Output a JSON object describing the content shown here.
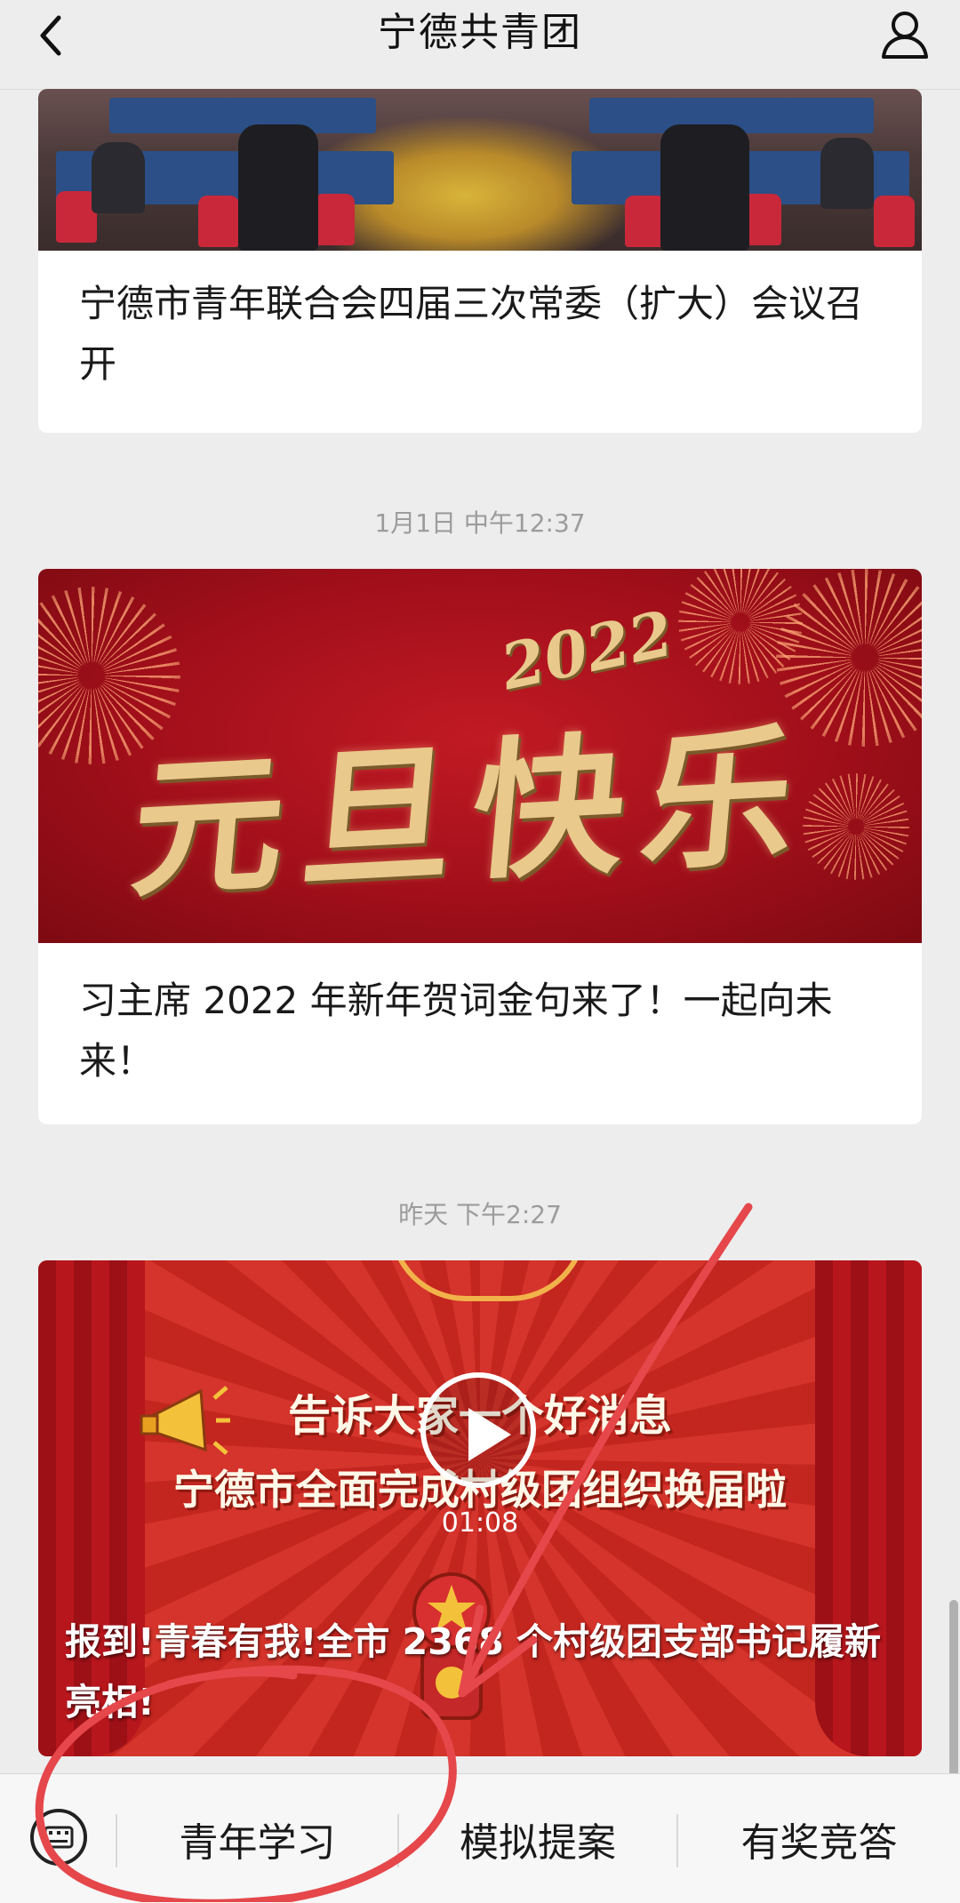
{
  "header": {
    "title": "宁德共青团"
  },
  "feed": {
    "articles": [
      {
        "title": "宁德市青年联合会四届三次常委（扩大）会议召开"
      },
      {
        "timestamp": "1月1日 中午12:37",
        "banner_text": "元旦快乐",
        "banner_year": "2022",
        "title": "习主席 2022 年新年贺词金句来了！一起向未来！"
      },
      {
        "timestamp": "昨天 下午2:27",
        "video_headline": "告诉大家一个好消息",
        "video_subheadline": "宁德市全面完成村级团组织换届啦",
        "duration": "01:08",
        "title": "报到!青春有我!全市 2368 个村级团支部书记履新亮相!"
      }
    ]
  },
  "bottom_menu": {
    "items": [
      {
        "label": "青年学习"
      },
      {
        "label": "模拟提案"
      },
      {
        "label": "有奖竞答"
      }
    ]
  },
  "colors": {
    "annotation": "#e5474b",
    "background": "#ededed",
    "banner_red": "#b3141e"
  },
  "icons": {
    "back": "chevron-left-icon",
    "profile": "person-icon",
    "keyboard": "keyboard-icon",
    "play": "play-icon"
  }
}
